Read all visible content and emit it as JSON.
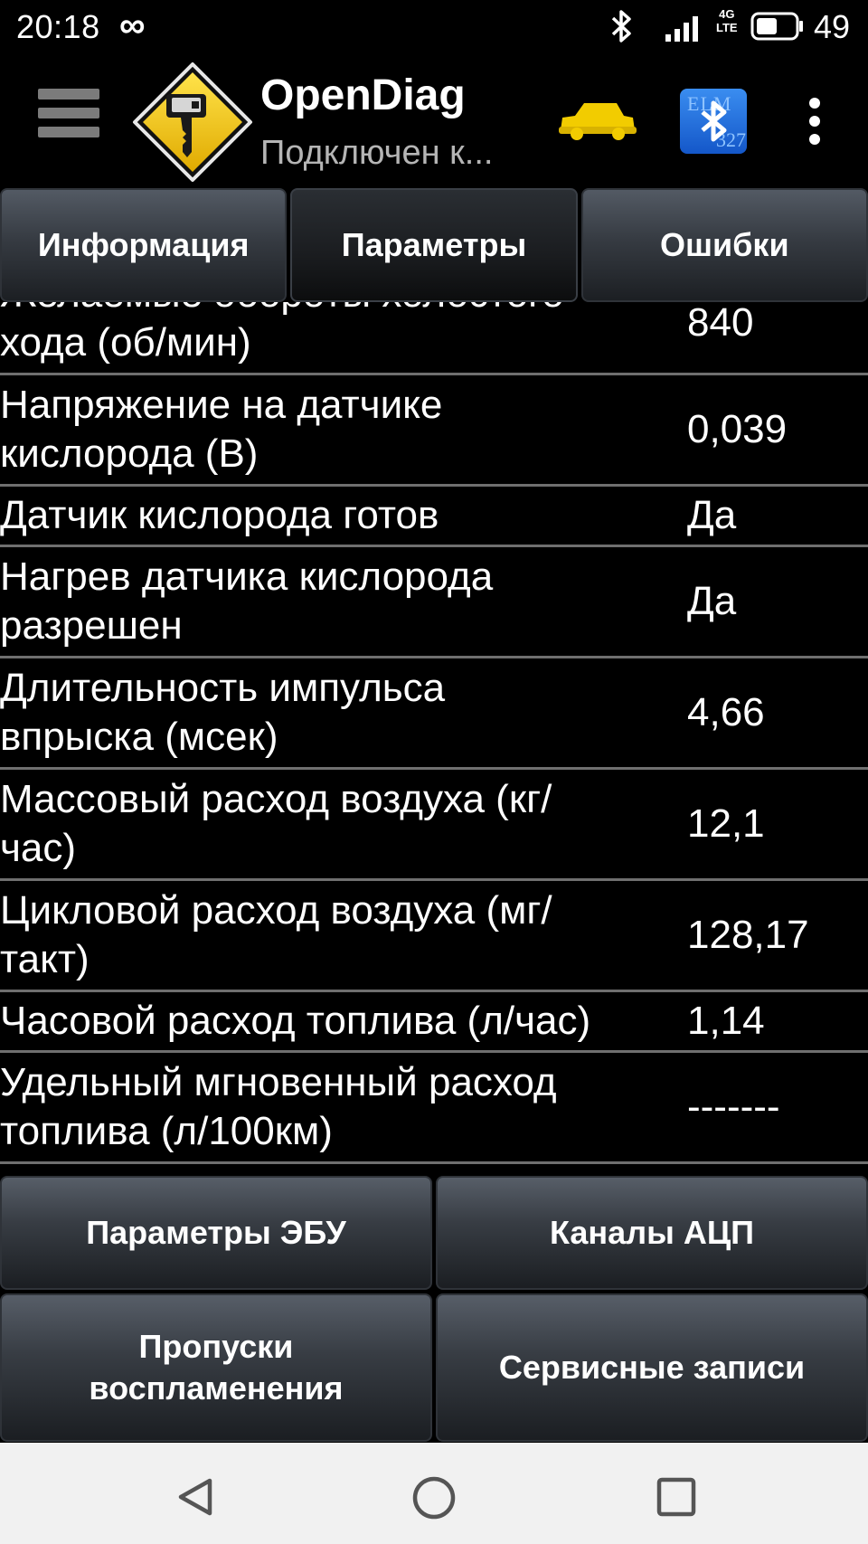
{
  "status_bar": {
    "time": "20:18",
    "infinity_symbol": "∞",
    "network_top": "4G",
    "network_bottom": "LTE",
    "battery_level": "49",
    "icons": [
      "bluetooth-icon",
      "signal-icon",
      "battery-icon"
    ]
  },
  "action_bar": {
    "title": "OpenDiag",
    "subtitle": "Подключен к...",
    "bt_adapter_text_top": "ELM",
    "bt_adapter_text_bottom": "327",
    "icons": [
      "menu-icon",
      "app-logo-key-icon",
      "car-icon",
      "bluetooth-adapter-icon",
      "overflow-menu-icon"
    ],
    "accent_color": "#f2cc00"
  },
  "tabs": [
    {
      "label": "Информация",
      "selected": false
    },
    {
      "label": "Параметры",
      "selected": true
    },
    {
      "label": "Ошибки",
      "selected": false
    }
  ],
  "params": [
    {
      "name_line1": "Желаемые обороты холостого",
      "name_line2": "хода (об/мин)",
      "value": "840"
    },
    {
      "name_line1": "Напряжение на датчике",
      "name_line2": "кислорода (В)",
      "value": "0,039"
    },
    {
      "name_line1": "Датчик кислорода готов",
      "name_line2": "",
      "value": "Да"
    },
    {
      "name_line1": "Нагрев датчика кислорода",
      "name_line2": "разрешен",
      "value": "Да"
    },
    {
      "name_line1": "Длительность импульса",
      "name_line2": "впрыска (мсек)",
      "value": "4,66"
    },
    {
      "name_line1": "Массовый расход воздуха (кг/",
      "name_line2": "час)",
      "value": "12,1"
    },
    {
      "name_line1": "Цикловой расход воздуха (мг/",
      "name_line2": "такт)",
      "value": "128,17"
    },
    {
      "name_line1": "Часовой расход топлива (л/час)",
      "name_line2": "",
      "value": "1,14"
    },
    {
      "name_line1": "Удельный мгновенный расход",
      "name_line2": "топлива (л/100км)",
      "value": "-------"
    }
  ],
  "buttons": {
    "ecu_params": "Параметры ЭБУ",
    "adc_channels": "Каналы АЦП",
    "misfires_line1": "Пропуски",
    "misfires_line2": "воспламенения",
    "service_records": "Сервисные записи"
  },
  "nav_bar": {
    "icons": [
      "back-icon",
      "home-icon",
      "recents-icon"
    ]
  }
}
